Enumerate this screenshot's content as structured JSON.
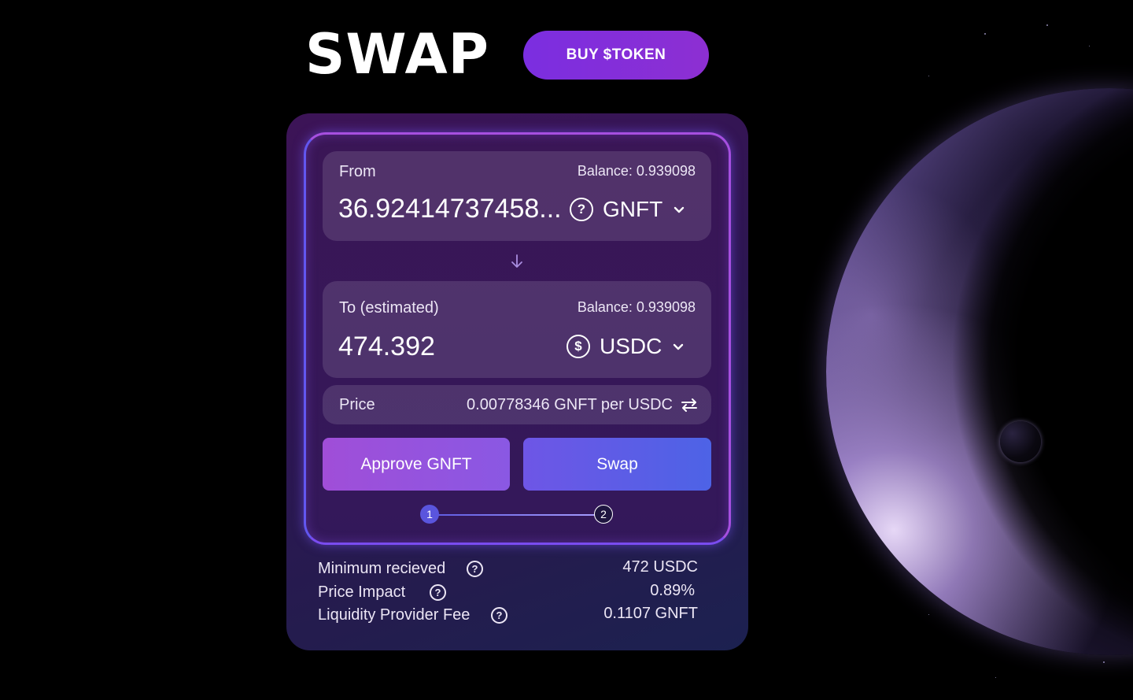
{
  "header": {
    "title": "SWAP",
    "buy_label": "BUY $TOKEN"
  },
  "from": {
    "label": "From",
    "balance": "Balance: 0.939098",
    "amount": "36.92414737458...",
    "token": "GNFT",
    "token_icon": "question-circle-icon"
  },
  "to": {
    "label": "To (estimated)",
    "balance": "Balance: 0.939098",
    "amount": "474.392",
    "token": "USDC",
    "token_icon": "dollar-circle-icon"
  },
  "price": {
    "label": "Price",
    "value": "0.00778346 GNFT per USDC"
  },
  "actions": {
    "approve_label": "Approve GNFT",
    "swap_label": "Swap"
  },
  "steps": [
    "1",
    "2"
  ],
  "details": [
    {
      "label": "Minimum recieved",
      "value": "472 USDC"
    },
    {
      "label": "Price Impact",
      "value": "0.89%"
    },
    {
      "label": "Liquidity Provider Fee",
      "value": "0.1107 GNFT"
    }
  ],
  "colors": {
    "accent": "#8d2fd2",
    "approve": "#a04ed8",
    "swap": "#4d63e6",
    "background": "#000000"
  }
}
